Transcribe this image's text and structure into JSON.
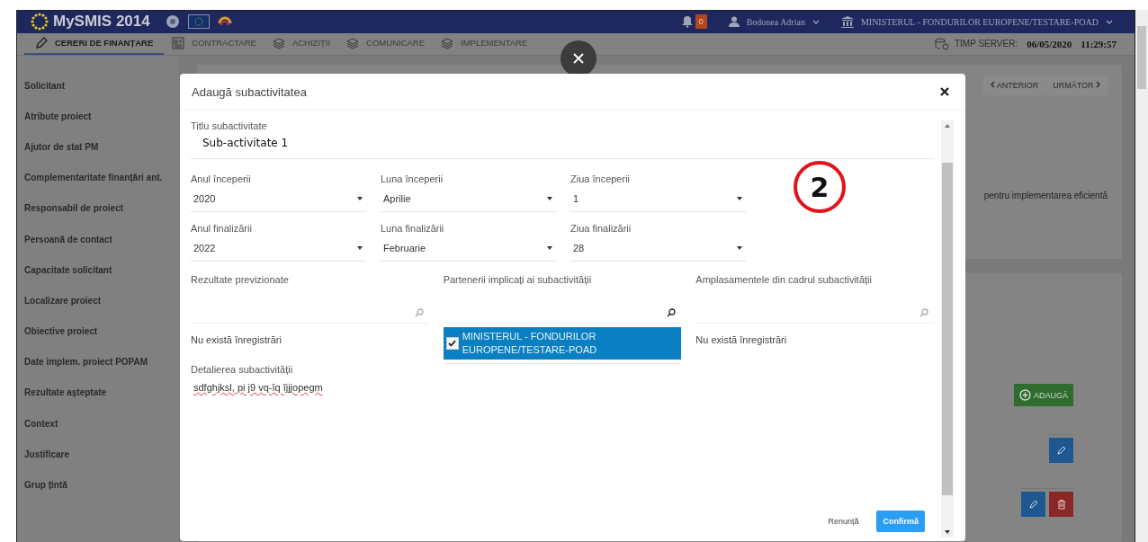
{
  "header": {
    "app_title": "MySMIS 2014",
    "notifications_count": "0",
    "user": "Bodonea Adrian",
    "organization": "MINISTERUL - FONDURILOR EUROPENE/TESTARE-POAD"
  },
  "nav": {
    "tabs": [
      {
        "label": "CERERI DE FINANȚARE",
        "selected": true
      },
      {
        "label": "CONTRACTARE",
        "selected": false
      },
      {
        "label": "ACHIZIȚII",
        "selected": false
      },
      {
        "label": "COMUNICARE",
        "selected": false
      },
      {
        "label": "IMPLEMENTARE",
        "selected": false
      }
    ],
    "server_time_label": "TIMP SERVER:",
    "server_date": "06/05/2020",
    "server_clock": "11:29:57"
  },
  "sidebar": {
    "items": [
      {
        "label": "Solicitant"
      },
      {
        "label": "Atribute proiect"
      },
      {
        "label": "Ajutor de stat PM"
      },
      {
        "label": "Complementaritate finanțări ant."
      },
      {
        "label": "Responsabil de proiect"
      },
      {
        "label": "Persoană de contact"
      },
      {
        "label": "Capacitate solicitant"
      },
      {
        "label": "Localizare proiect"
      },
      {
        "label": "Obiective proiect"
      },
      {
        "label": "Date implem. proiect POPAM"
      },
      {
        "label": "Rezultate așteptate"
      },
      {
        "label": "Context"
      },
      {
        "label": "Justificare"
      },
      {
        "label": "Grup țintă"
      }
    ]
  },
  "background": {
    "prev": "ANTERIOR",
    "next": "URMĂTOR",
    "text_fragment": "pentru implementarea eficientă",
    "add_button": "ADAUGĂ"
  },
  "modal": {
    "title": "Adaugă subactivitatea",
    "title_field": {
      "label": "Titlu subactivitate",
      "value": "Sub-activitate 1"
    },
    "selects": [
      {
        "label": "Anul începerii",
        "value": "2020"
      },
      {
        "label": "Luna începerii",
        "value": "Aprilie"
      },
      {
        "label": "Ziua începerii",
        "value": "1"
      },
      {
        "label": "Anul finalizării",
        "value": "2022"
      },
      {
        "label": "Luna finalizării",
        "value": "Februarie"
      },
      {
        "label": "Ziua finalizării",
        "value": "28"
      }
    ],
    "lookups": [
      {
        "label": "Rezultate previzionate",
        "empty_text": "Nu există înregistrări"
      },
      {
        "label": "Partenerii implicați ai subactivității",
        "items": [
          {
            "label": "MINISTERUL - FONDURILOR EUROPENE/TESTARE-POAD",
            "checked": true
          }
        ]
      },
      {
        "label": "Amplasamentele din cadrul subactivității",
        "empty_text": "Nu există înregistrări"
      }
    ],
    "details": {
      "label": "Detalierea subactivității",
      "value": "sdfghjksl, pi j9 vq-îq îjjjopegm"
    },
    "cancel": "Renunță",
    "confirm": "Confirmă"
  },
  "annotation_marker": "2"
}
